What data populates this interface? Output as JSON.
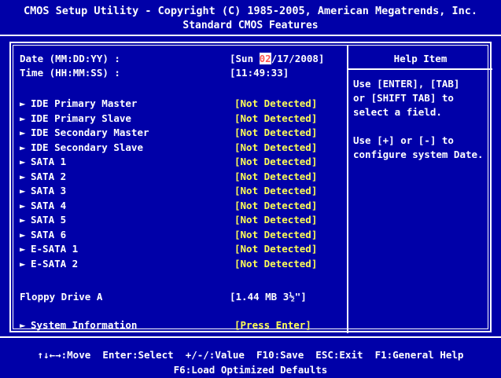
{
  "header": {
    "title": "CMOS Setup Utility - Copyright (C) 1985-2005, American Megatrends, Inc.",
    "subtitle": "Standard CMOS Features"
  },
  "date": {
    "label": "Date (MM:DD:YY) :",
    "prefix": "[Sun ",
    "month": "02",
    "rest": "/17/2008]"
  },
  "time": {
    "label": "Time (HH:MM:SS) :",
    "value": "[11:49:33]"
  },
  "items": [
    {
      "label": "IDE Primary Master",
      "value": "[Not Detected]"
    },
    {
      "label": "IDE Primary Slave",
      "value": "[Not Detected]"
    },
    {
      "label": "IDE Secondary Master",
      "value": "[Not Detected]"
    },
    {
      "label": "IDE Secondary Slave",
      "value": "[Not Detected]"
    },
    {
      "label": "SATA 1",
      "value": "[Not Detected]"
    },
    {
      "label": "SATA 2",
      "value": "[Not Detected]"
    },
    {
      "label": "SATA 3",
      "value": "[Not Detected]"
    },
    {
      "label": "SATA 4",
      "value": "[Not Detected]"
    },
    {
      "label": "SATA 5",
      "value": "[Not Detected]"
    },
    {
      "label": "SATA 6",
      "value": "[Not Detected]"
    },
    {
      "label": "E-SATA 1",
      "value": "[Not Detected]"
    },
    {
      "label": "E-SATA 2",
      "value": "[Not Detected]"
    }
  ],
  "floppy": {
    "label": "Floppy Drive A",
    "value": "[1.44 MB 3½\"]"
  },
  "sysinfo": {
    "label": "System Information",
    "value": "[Press Enter]"
  },
  "help": {
    "title": "Help Item",
    "lines": [
      "Use [ENTER], [TAB]",
      "or [SHIFT TAB] to",
      "select a field.",
      "",
      "Use [+] or [-] to",
      "configure system Date."
    ]
  },
  "footer": {
    "move": "↑↓←→:Move",
    "select": "Enter:Select",
    "value": "+/-/:Value",
    "save": "F10:Save",
    "exit": "ESC:Exit",
    "help": "F1:General Help",
    "defaults": "F6:Load Optimized Defaults"
  },
  "colors": {
    "background": "#0000a8",
    "text": "#ffffff",
    "value_yellow": "#ffff55",
    "highlight_text": "#ff5555",
    "highlight_bg": "#ffffff"
  },
  "icons": {
    "submenu": "triangle-right-icon"
  }
}
